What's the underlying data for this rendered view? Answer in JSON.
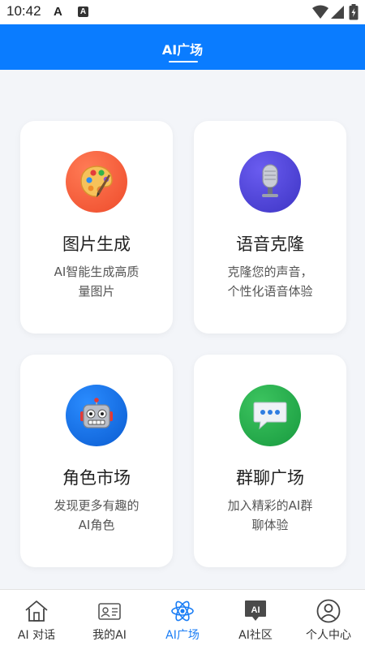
{
  "status_bar": {
    "time": "10:42",
    "icon_a1": "A",
    "icon_a2": "A"
  },
  "header": {
    "title": "AI广场"
  },
  "cards": [
    {
      "title": "图片生成",
      "desc_line1": "AI智能生成高质",
      "desc_line2": "量图片",
      "icon": "palette-icon",
      "color": "#f0563c"
    },
    {
      "title": "语音克隆",
      "desc_line1": "克隆您的声音，",
      "desc_line2": "个性化语音体验",
      "icon": "microphone-icon",
      "color": "#4c42d6"
    },
    {
      "title": "角色市场",
      "desc_line1": "发现更多有趣的",
      "desc_line2": "AI角色",
      "icon": "robot-icon",
      "color": "#0f6fe0"
    },
    {
      "title": "群聊广场",
      "desc_line1": "加入精彩的AI群",
      "desc_line2": "聊体验",
      "icon": "chat-bubble-icon",
      "color": "#1fa44a"
    }
  ],
  "tabs": [
    {
      "label": "AI 对话",
      "icon": "home-icon",
      "active": false
    },
    {
      "label": "我的AI",
      "icon": "id-card-icon",
      "active": false
    },
    {
      "label": "AI广场",
      "icon": "atom-icon",
      "active": true
    },
    {
      "label": "AI社区",
      "icon": "ai-chat-icon",
      "active": false
    },
    {
      "label": "个人中心",
      "icon": "user-icon",
      "active": false
    }
  ],
  "colors": {
    "primary": "#0a7cff",
    "active_tab": "#1a7df5"
  }
}
